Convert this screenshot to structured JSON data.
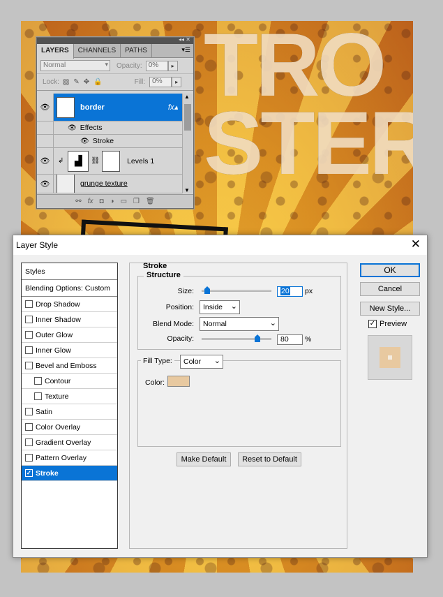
{
  "poster": {
    "text_line1": "TRO",
    "text_line2": "STER"
  },
  "layers_panel": {
    "tabs": [
      "LAYERS",
      "CHANNELS",
      "PATHS"
    ],
    "blend_mode": "Normal",
    "opacity_label": "Opacity:",
    "opacity_value": "0%",
    "lock_label": "Lock:",
    "fill_label": "Fill:",
    "fill_value": "0%",
    "layers": [
      {
        "name": "border",
        "selected": true
      },
      {
        "name": "Effects"
      },
      {
        "name": "Stroke"
      },
      {
        "name": "Levels 1"
      },
      {
        "name": "grunge texture"
      }
    ]
  },
  "dialog": {
    "title": "Layer Style",
    "styles_header": "Styles",
    "blending": "Blending Options: Custom",
    "style_items": [
      {
        "label": "Drop Shadow",
        "checked": false,
        "sub": false
      },
      {
        "label": "Inner Shadow",
        "checked": false,
        "sub": false
      },
      {
        "label": "Outer Glow",
        "checked": false,
        "sub": false
      },
      {
        "label": "Inner Glow",
        "checked": false,
        "sub": false
      },
      {
        "label": "Bevel and Emboss",
        "checked": false,
        "sub": false
      },
      {
        "label": "Contour",
        "checked": false,
        "sub": true
      },
      {
        "label": "Texture",
        "checked": false,
        "sub": true
      },
      {
        "label": "Satin",
        "checked": false,
        "sub": false
      },
      {
        "label": "Color Overlay",
        "checked": false,
        "sub": false
      },
      {
        "label": "Gradient Overlay",
        "checked": false,
        "sub": false
      },
      {
        "label": "Pattern Overlay",
        "checked": false,
        "sub": false
      },
      {
        "label": "Stroke",
        "checked": true,
        "sub": false,
        "active": true
      }
    ],
    "stroke": {
      "section_title": "Stroke",
      "structure_title": "Structure",
      "size_label": "Size:",
      "size_value": "20",
      "size_unit": "px",
      "size_fraction": 0.08,
      "position_label": "Position:",
      "position_value": "Inside",
      "blend_label": "Blend Mode:",
      "blend_value": "Normal",
      "opacity_label": "Opacity:",
      "opacity_value": "80",
      "opacity_unit": "%",
      "opacity_fraction": 0.8,
      "fill_type_label": "Fill Type:",
      "fill_type_value": "Color",
      "color_label": "Color:",
      "color_hex": "#e8c9a0",
      "make_default": "Make Default",
      "reset_default": "Reset to Default"
    },
    "buttons": {
      "ok": "OK",
      "cancel": "Cancel",
      "new_style": "New Style...",
      "preview": "Preview"
    },
    "preview_checked": true
  }
}
